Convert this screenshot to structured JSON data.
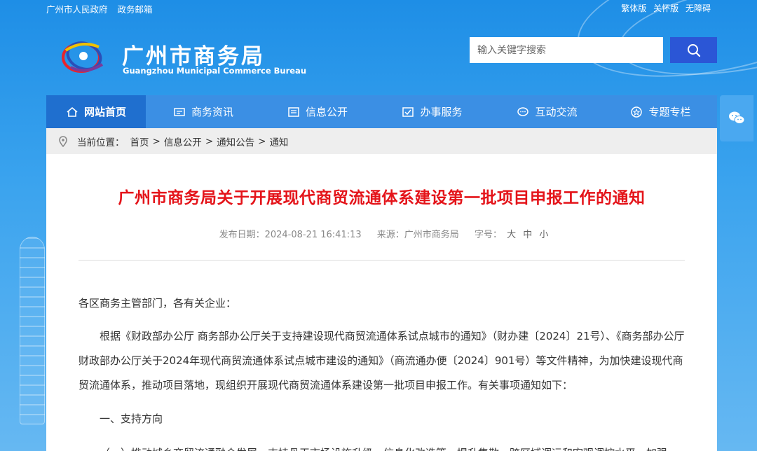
{
  "topbar": {
    "links_left": [
      "广州市人民政府",
      "政务邮箱"
    ],
    "links_right": [
      "繁体版",
      "关怀版",
      "无障碍"
    ]
  },
  "header": {
    "title": "广州市商务局",
    "subtitle": "Guangzhou Municipal Commerce Bureau"
  },
  "search": {
    "placeholder": "输入关键字搜索"
  },
  "nav": {
    "items": [
      {
        "label": "网站首页",
        "icon": "home-icon"
      },
      {
        "label": "商务资讯",
        "icon": "news-icon"
      },
      {
        "label": "信息公开",
        "icon": "info-icon"
      },
      {
        "label": "办事服务",
        "icon": "service-icon"
      },
      {
        "label": "互动交流",
        "icon": "chat-icon"
      },
      {
        "label": "专题专栏",
        "icon": "topic-icon"
      }
    ]
  },
  "breadcrumb": {
    "prefix": "当前位置：",
    "items": [
      "首页",
      "信息公开",
      "通知公告",
      "通知"
    ]
  },
  "article": {
    "title": "广州市商务局关于开展现代商贸流通体系建设第一批项目申报工作的通知",
    "date_label": "发布日期：2024-08-21 16:41:13",
    "source_label": "来源：广州市商务局",
    "font_label": "字号：",
    "font_sizes": [
      "大",
      "中",
      "小"
    ],
    "p1": "各区商务主管部门，各有关企业：",
    "p2": "根据《财政部办公厅 商务部办公厅关于支持建设现代商贸流通体系试点城市的通知》（财办建〔2024〕21号）、《商务部办公厅 财政部办公厅关于2024年现代商贸流通体系试点城市建设的通知》（商流通办便〔2024〕901号）等文件精神，为加快建设现代商贸流通体系，推动项目落地，现组织开展现代商贸流通体系建设第一批项目申报工作。有关事项通知如下：",
    "p3": "一、支持方向",
    "p4": "（一）推动城乡商贸流通融合发展。支持骨干市场设施升级、信息化改造等，提升集散、跨区域调运和宏观调控水平，加强"
  },
  "colors": {
    "accent": "#2b56d6",
    "title_red": "#e4141a",
    "nav_bg": "#3b8fe4",
    "nav_active": "#1f6fcf"
  }
}
